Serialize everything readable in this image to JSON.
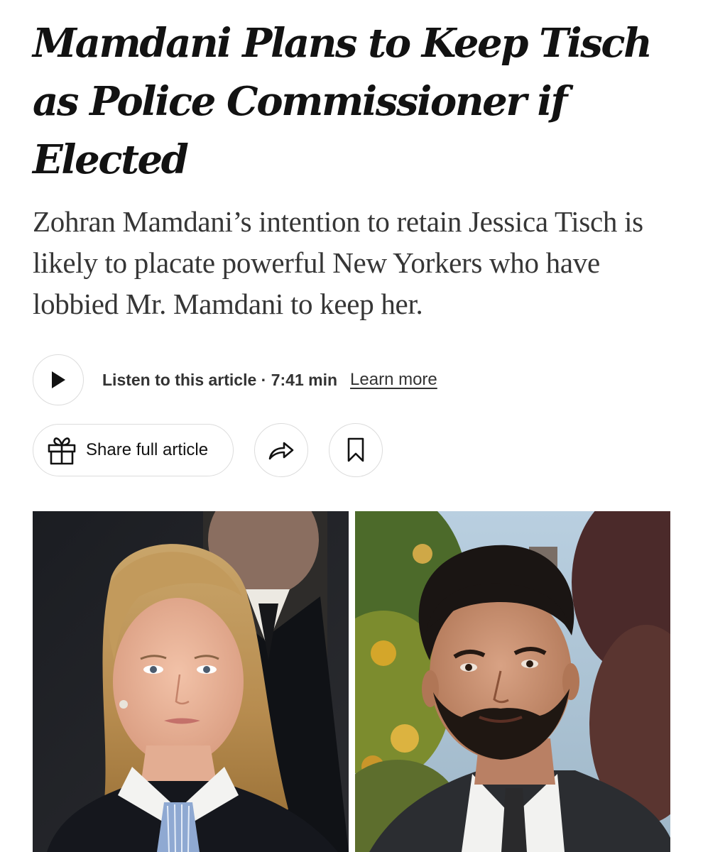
{
  "article": {
    "headline": "Mamdani Plans to Keep Tisch as Police Commissioner if Elected",
    "summary": "Zohran Mamdani’s intention to retain Jessica Tisch is likely to placate powerful New Yorkers who have lobbied Mr. Mamdani to keep her."
  },
  "audio": {
    "play_icon": "play-icon",
    "listen_label": "Listen to this article · 7:41 min",
    "learn_more_label": "Learn more"
  },
  "actions": {
    "share_full_label": "Share full article",
    "gift_icon": "gift-icon",
    "share_icon": "share-arrow-icon",
    "save_icon": "bookmark-icon"
  },
  "photos": [
    {
      "subject": "Jessica Tisch portrait"
    },
    {
      "subject": "Zohran Mamdani portrait"
    }
  ],
  "colors": {
    "text": "#121212",
    "summary_text": "#363636",
    "button_border": "#dcdcdc"
  }
}
